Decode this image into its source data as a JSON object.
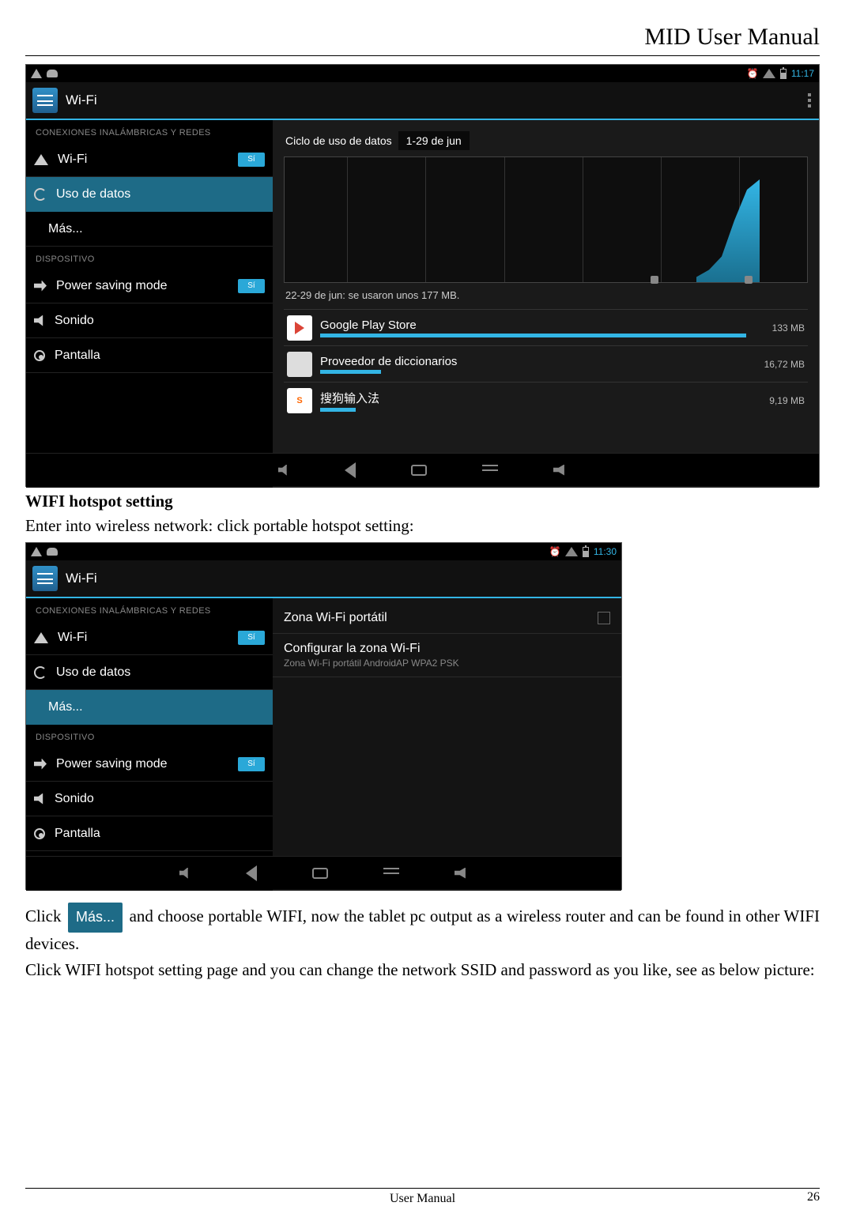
{
  "doc": {
    "title": "MID User Manual",
    "footer_center": "User Manual",
    "page_num": "26"
  },
  "text": {
    "wifi_heading": "WIFI hotspot setting",
    "wifi_sub": "Enter into wireless network: click portable hotspot setting:",
    "para1a": "Click ",
    "mas_chip": "Más...",
    "para1b": " and choose portable WIFI, now the tablet pc output as a wireless router and can be found in other WIFI devices.",
    "para2": "Click WIFI hotspot setting page and you can change the network SSID and password as you like, see as below picture:"
  },
  "shot1": {
    "time": "11:17",
    "title": "Wi-Fi",
    "sect_wireless": "CONEXIONES INALÁMBRICAS Y REDES",
    "sect_device": "DISPOSITIVO",
    "rows": {
      "wifi": "Wi-Fi",
      "wifi_toggle": "Sí",
      "data": "Uso de datos",
      "mas": "Más...",
      "psm": "Power saving mode",
      "psm_toggle": "Sí",
      "snd": "Sonido",
      "pant": "Pantalla"
    },
    "cycle_label": "Ciclo de uso de datos",
    "cycle_range": "1-29 de jun",
    "usage_note": "22-29 de jun: se usaron unos 177 MB.",
    "apps": [
      {
        "name": "Google Play Store",
        "size": "133 MB",
        "bar": 100
      },
      {
        "name": "Proveedor de diccionarios",
        "size": "16,72 MB",
        "bar": 14
      },
      {
        "name": "搜狗输入法",
        "size": "9,19 MB",
        "bar": 8
      }
    ]
  },
  "shot2": {
    "time": "11:30",
    "title": "Wi-Fi",
    "sect_wireless": "CONEXIONES INALÁMBRICAS Y REDES",
    "sect_device": "DISPOSITIVO",
    "rows": {
      "wifi": "Wi-Fi",
      "wifi_toggle": "Sí",
      "data": "Uso de datos",
      "mas": "Más...",
      "psm": "Power saving mode",
      "psm_toggle": "Sí",
      "snd": "Sonido",
      "pant": "Pantalla"
    },
    "opt1": "Zona Wi-Fi portátil",
    "opt2_main": "Configurar la zona Wi-Fi",
    "opt2_sub": "Zona Wi-Fi portátil AndroidAP WPA2 PSK"
  }
}
